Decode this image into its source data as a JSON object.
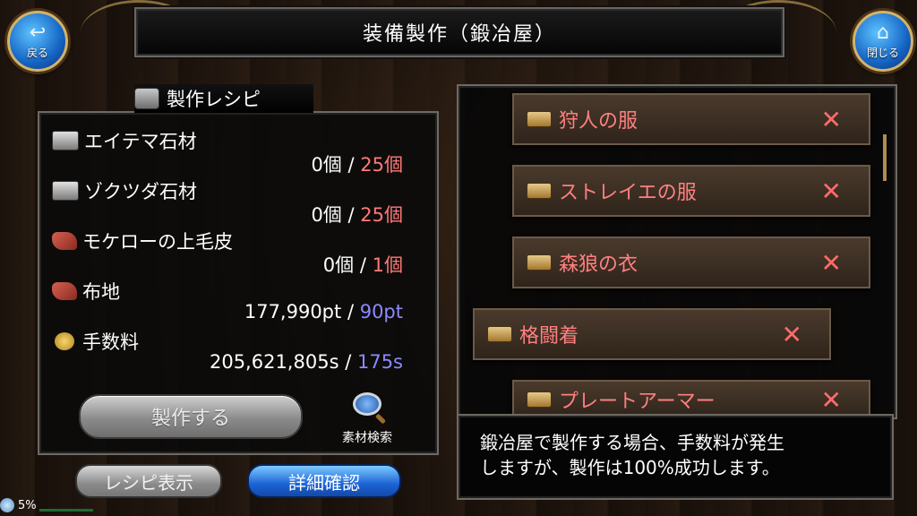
{
  "header": {
    "title": "装備製作（鍛冶屋）"
  },
  "nav": {
    "back_label": "戻る",
    "back_icon": "back-arrow-icon",
    "close_label": "閉じる",
    "close_icon": "home-icon"
  },
  "recipe_panel": {
    "title": "製作レシピ",
    "materials": [
      {
        "name": "エイテマ石材",
        "have": "0個",
        "sep": "/",
        "need": "25個",
        "icon": "stone-icon"
      },
      {
        "name": "ゾクツダ石材",
        "have": "0個",
        "sep": "/",
        "need": "25個",
        "icon": "stone-icon"
      },
      {
        "name": "モケローの上毛皮",
        "have": "0個",
        "sep": "/",
        "need": "1個",
        "icon": "fur-icon"
      },
      {
        "name": "布地",
        "have": "177,990pt",
        "sep": "/",
        "need": "90pt",
        "icon": "cloth-icon"
      },
      {
        "name": "手数料",
        "have": "205,621,805s",
        "sep": "/",
        "need": "175s",
        "icon": "coin-icon"
      }
    ],
    "make_button": "製作する",
    "search_label": "素材検索"
  },
  "bottom_buttons": {
    "recipe_display": "レシピ表示",
    "detail_confirm": "詳細確認"
  },
  "status": {
    "percent": "5%"
  },
  "recipe_list": [
    {
      "name": "狩人の服"
    },
    {
      "name": "ストレイエの服"
    },
    {
      "name": "森狼の衣"
    },
    {
      "name": "格闘着"
    },
    {
      "name": "プレートアーマー"
    }
  ],
  "info": {
    "line1": "鍛冶屋で製作する場合、手数料が発生",
    "line2": "しますが、製作は100%成功します。"
  },
  "colors": {
    "need_red": "#ff7a7a",
    "need_blue": "#8a8aff",
    "item_text": "#ff8080",
    "accent_blue": "#1c63d6"
  }
}
